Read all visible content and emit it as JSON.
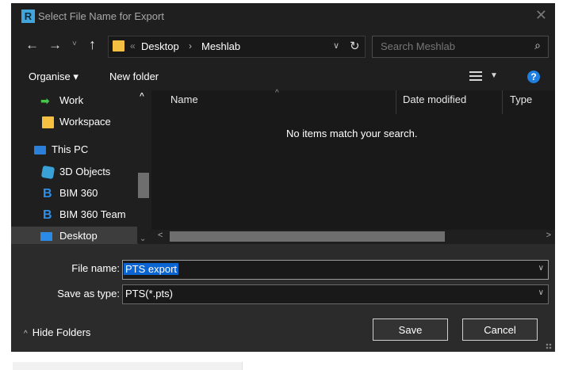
{
  "window": {
    "app_icon_letter": "R",
    "title": "Select File Name for Export",
    "close_glyph": "✕"
  },
  "nav": {
    "back_glyph": "←",
    "forward_glyph": "→",
    "recent_glyph": "˅",
    "up_glyph": "↑",
    "address_chevron": "«",
    "breadcrumbs": [
      "Desktop",
      "Meshlab"
    ],
    "breadcrumb_separator": "›",
    "address_dropdown_glyph": "∨",
    "refresh_glyph": "↻",
    "search_placeholder": "Search Meshlab",
    "search_glyph": "⌕"
  },
  "toolbar": {
    "organise_label": "Organise ▾",
    "new_folder_label": "New folder",
    "view_dropdown_glyph": "▼",
    "help_label": "?"
  },
  "nav_pane": {
    "items": [
      {
        "label": "Work",
        "icon": "pin-arrow-icon"
      },
      {
        "label": "Workspace",
        "icon": "folder-icon"
      },
      {
        "label": "This PC",
        "icon": "computer-icon"
      },
      {
        "label": "3D Objects",
        "icon": "3d-objects-icon"
      },
      {
        "label": "BIM 360",
        "icon": "bim360-icon"
      },
      {
        "label": "BIM 360 Team",
        "icon": "bim360-icon"
      },
      {
        "label": "Desktop",
        "icon": "desktop-icon",
        "selected": true
      }
    ],
    "scroll_up_glyph": "^",
    "scroll_down_glyph": "⌄"
  },
  "file_list": {
    "columns": [
      "Name",
      "Date modified",
      "Type"
    ],
    "sort_glyph": "^",
    "empty_message": "No items match your search.",
    "scroll_left_glyph": "<",
    "scroll_right_glyph": ">"
  },
  "form": {
    "file_name_label": "File name:",
    "file_name_value": "PTS export",
    "save_as_type_label": "Save as type:",
    "save_as_type_value": "PTS(*.pts)",
    "dropdown_glyph": "∨"
  },
  "footer": {
    "hide_folders_caret": "^",
    "hide_folders_label": "Hide Folders",
    "save_label": "Save",
    "cancel_label": "Cancel"
  },
  "colors": {
    "dialog_bg": "#1f1f1f",
    "list_bg": "#191919",
    "bottom_bg": "#2b2b2b",
    "selection_blue": "#0a64d2",
    "folder_yellow": "#f5c042"
  }
}
